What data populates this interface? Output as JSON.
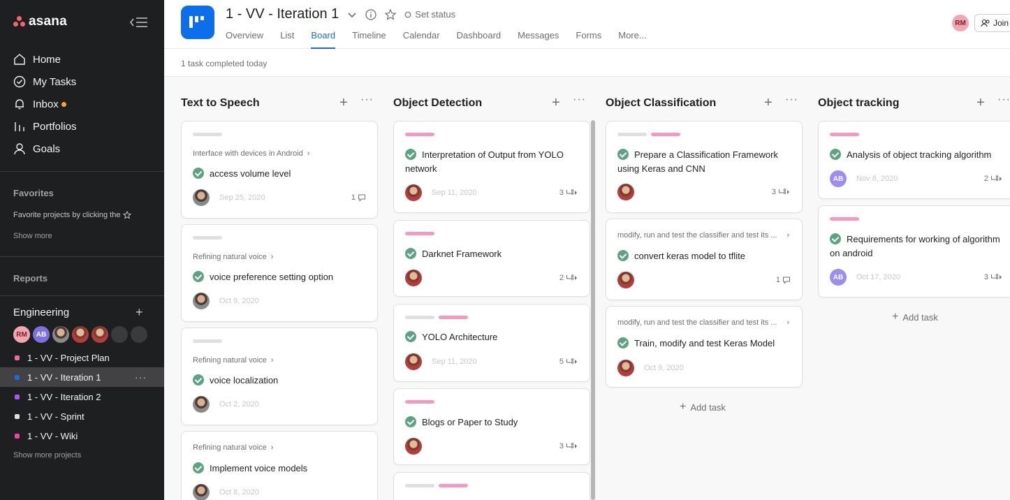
{
  "sidebar": {
    "logo": "asana",
    "nav": [
      {
        "label": "Home",
        "icon": "home-icon"
      },
      {
        "label": "My Tasks",
        "icon": "check-circle-icon"
      },
      {
        "label": "Inbox",
        "icon": "bell-icon"
      },
      {
        "label": "Portfolios",
        "icon": "bar-chart-icon"
      },
      {
        "label": "Goals",
        "icon": "person-icon"
      }
    ],
    "favorites_title": "Favorites",
    "favorites_text": "Favorite projects by clicking the",
    "show_more": "Show more",
    "reports_title": "Reports",
    "team_title": "Engineering",
    "team_avatars": [
      "RM",
      "AB"
    ],
    "projects": [
      {
        "label": "1 - VV - Project Plan",
        "color": "#f06a9f"
      },
      {
        "label": "1 - VV - Iteration 1",
        "color": "#1e6bd6"
      },
      {
        "label": "1 - VV - Iteration 2",
        "color": "#a855f7"
      },
      {
        "label": "1 - VV - Sprint",
        "color": "#e0dfdf"
      },
      {
        "label": "1 - VV - Wiki",
        "color": "#ec4899"
      }
    ],
    "show_more_projects": "Show more projects",
    "more_dots": "···"
  },
  "header": {
    "title": "1 - VV - Iteration 1",
    "set_status": "Set status",
    "tabs": [
      "Overview",
      "List",
      "Board",
      "Timeline",
      "Calendar",
      "Dashboard",
      "Messages",
      "Forms",
      "More..."
    ],
    "user_initials": "RM",
    "join_label": "Join",
    "subtitle": "1 task completed today"
  },
  "board": {
    "add_task": "Add task",
    "columns": [
      {
        "title": "Text to Speech",
        "cards": [
          {
            "parent": "Interface with devices in Android",
            "task": "access volume level",
            "date": "Sep 25, 2020",
            "meta": "1"
          },
          {
            "parent": "Refining natural voice",
            "task": "voice preference setting option",
            "date": "Oct 9, 2020",
            "meta": ""
          },
          {
            "parent": "Refining natural voice",
            "task": "voice localization",
            "date": "Oct 2, 2020",
            "meta": ""
          },
          {
            "parent": "Refining natural voice",
            "task": "Implement voice models",
            "date": "Oct 8, 2020",
            "meta": ""
          }
        ]
      },
      {
        "title": "Object Detection",
        "cards": [
          {
            "task": "Interpretation of Output from YOLO network",
            "date": "Sep 11, 2020",
            "meta": "3"
          },
          {
            "task": "Darknet Framework",
            "date": "",
            "meta": "2"
          },
          {
            "task": "YOLO Architecture",
            "date": "Sep 11, 2020",
            "meta": "5"
          },
          {
            "task": "Blogs or Paper to Study",
            "date": "",
            "meta": "3"
          }
        ]
      },
      {
        "title": "Object Classification",
        "cards": [
          {
            "task": "Prepare a Classification Framework using Keras and CNN",
            "date": "",
            "meta": "3"
          },
          {
            "parent": "modify, run and test the classifier and test its ...",
            "task": "convert keras model to tflite",
            "date": "",
            "meta": "1"
          },
          {
            "parent": "modify, run and test the classifier and test its ...",
            "task": "Train, modify and test Keras Model",
            "date": "Oct 9, 2020",
            "meta": ""
          }
        ]
      },
      {
        "title": "Object tracking",
        "cards": [
          {
            "task": "Analysis of object tracking algorithm",
            "date": "Nov 8, 2020",
            "meta": "2",
            "avatar": "AB"
          },
          {
            "task": "Requirements for working of algorithm on android",
            "date": "Oct 17, 2020",
            "meta": "3",
            "avatar": "AB"
          }
        ]
      }
    ]
  }
}
